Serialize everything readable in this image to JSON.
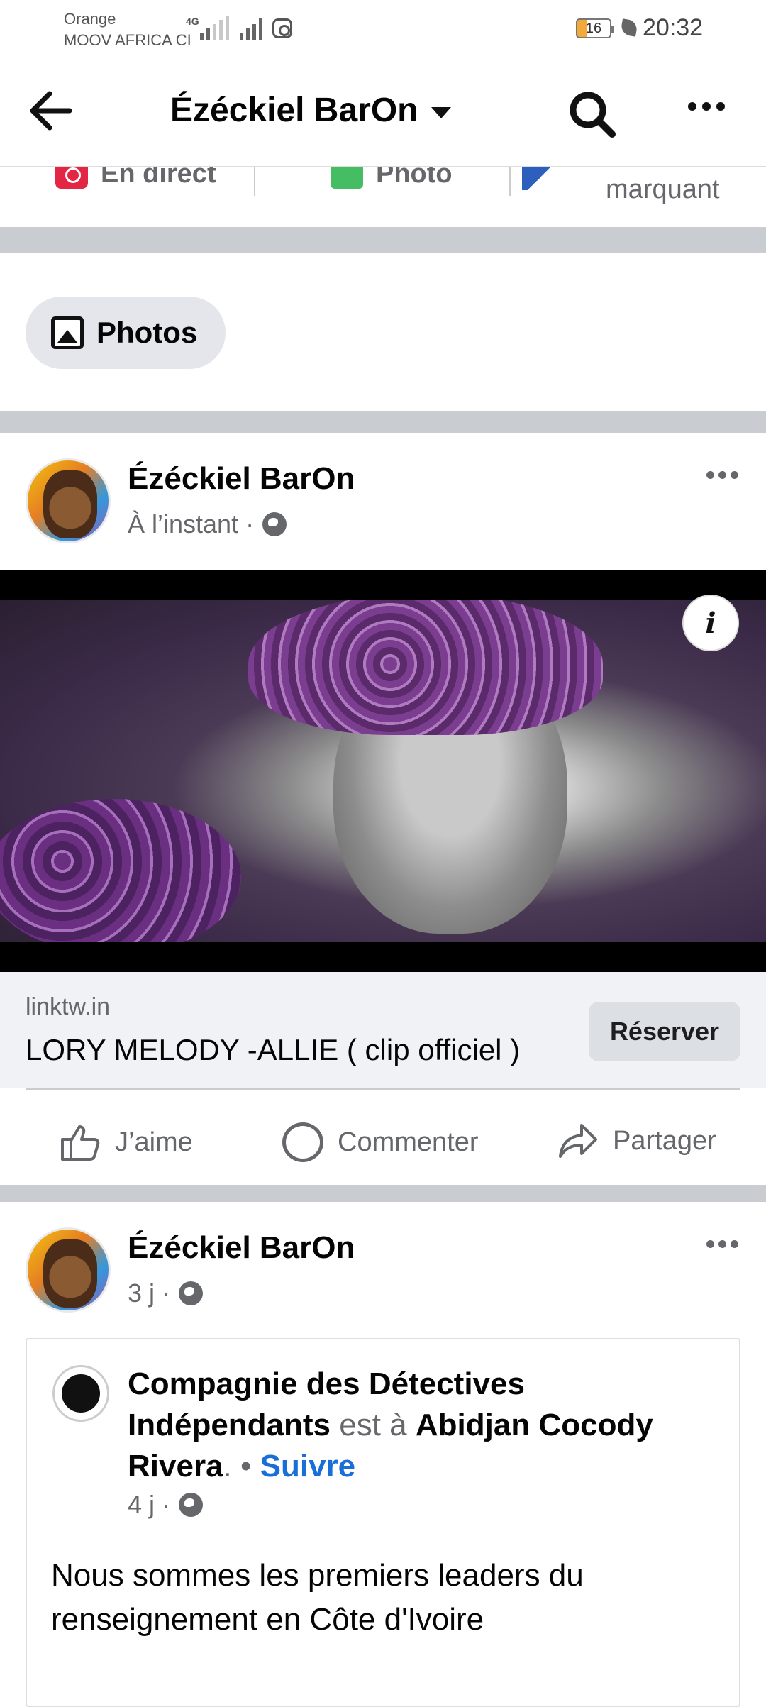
{
  "status_bar": {
    "carrier_line1": "Orange",
    "carrier_line2": "MOOV AFRICA CI",
    "network": "4G",
    "battery": "16",
    "time": "20:32"
  },
  "header": {
    "title": "Ézéckiel BarOn",
    "back_icon": "arrow-left-icon",
    "search_icon": "search-icon",
    "more_icon": "more-horizontal-icon"
  },
  "composer": {
    "live_label": "En direct",
    "photo_label": "Photo",
    "event_label": "marquant"
  },
  "photos_chip": {
    "label": "Photos"
  },
  "post1": {
    "author": "Ézéckiel BarOn",
    "time": "À l’instant ·",
    "link": {
      "domain": "linktw.in",
      "title": "LORY MELODY -ALLIE ( clip officiel )",
      "cta": "Réserver"
    },
    "actions": {
      "like": "J’aime",
      "comment": "Commenter",
      "share": "Partager"
    }
  },
  "post2": {
    "author": "Ézéckiel BarOn",
    "time": "3 j ·",
    "shared": {
      "page_name": "Compagnie des Détectives Indépendants",
      "is_at": "est à",
      "place": "Abidjan Cocody Rivera",
      "dot": ". •",
      "follow": "Suivre",
      "time": "4 j ·",
      "body_line1": "Nous sommes les premiers leaders du",
      "body_line2": "renseignement en Côte d'Ivoire"
    }
  },
  "colors": {
    "accent": "#1a6ed8",
    "divider": "#c9ccd1",
    "muted_text": "#65676b"
  }
}
